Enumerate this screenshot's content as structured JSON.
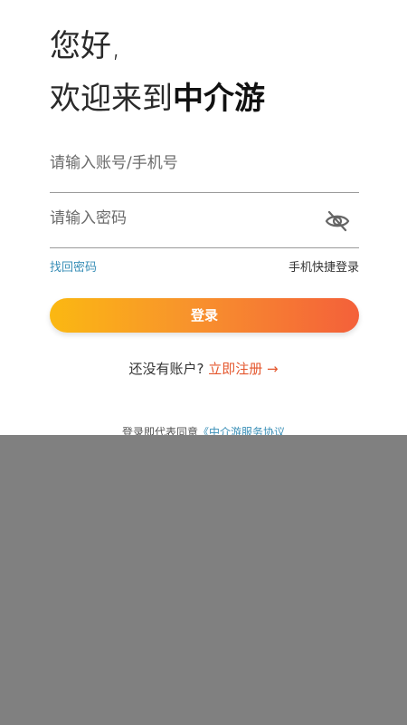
{
  "greeting": {
    "line1": "您好,",
    "line2_prefix": "欢迎来到",
    "brand": "中介游"
  },
  "form": {
    "account_placeholder": "请输入账号/手机号",
    "account_value": "",
    "password_placeholder": "请输入密码",
    "password_value": ""
  },
  "links": {
    "forgot_password": "找回密码",
    "sms_login": "手机快捷登录"
  },
  "login_button": "登录",
  "register": {
    "prompt": "还没有账户?",
    "link": "立即注册 →"
  },
  "agreement": {
    "prefix": "登录即代表同意",
    "link": "《中介游服务协议"
  },
  "icons": {
    "password_visibility": "eye-off-icon"
  },
  "colors": {
    "accent_start": "#fbb812",
    "accent_end": "#f4603a",
    "link_blue": "#3a8fb7",
    "register_red": "#e4572e",
    "overlay_gray": "#808080"
  }
}
